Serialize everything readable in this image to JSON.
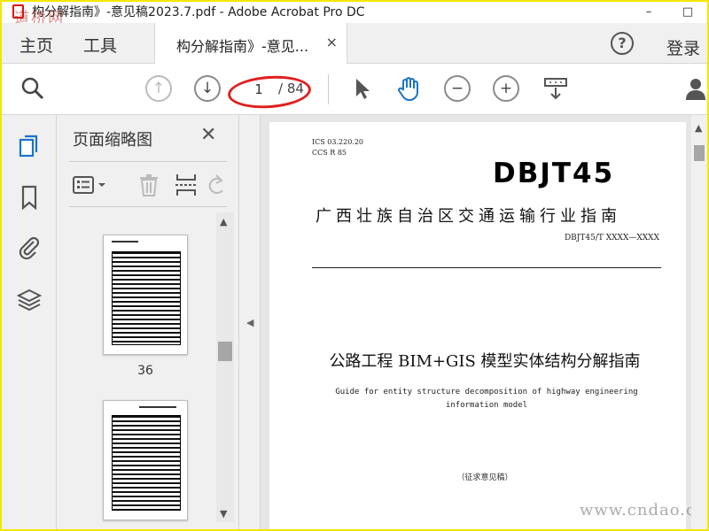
{
  "window": {
    "title": "构分解指南》-意见稿2023.7.pdf - Adobe Acrobat Pro DC",
    "controls": [
      "–",
      "□"
    ]
  },
  "watermark_top": "道桥网",
  "watermark_bottom": "www.cndao.com",
  "menu": {
    "home": "主页",
    "tools": "工具",
    "login": "登录"
  },
  "tab": {
    "label": "构分解指南》-意见...",
    "close": "×"
  },
  "toolbar": {
    "current_page": "1",
    "total_pages": "/ 84",
    "icons": [
      "search-icon",
      "prev-page-icon",
      "next-page-icon",
      "select-cursor-icon",
      "hand-tool-icon",
      "zoom-out-icon",
      "zoom-in-icon",
      "page-display-icon",
      "share-user-icon"
    ]
  },
  "panel": {
    "title": "页面缩略图",
    "close": "✕",
    "thumbnails": [
      {
        "page_number": "36"
      }
    ]
  },
  "document": {
    "ics": "ICS  03.220.20",
    "ccs": "CCS  R 85",
    "code": "DBJT45",
    "region_title": "广西壮族自治区交通运输行业指南",
    "standard_number": "DBJT45/T XXXX—XXXX",
    "main_title": "公路工程 BIM+GIS 模型实体结构分解指南",
    "english_title_line1": "Guide for entity structure decomposition of highway engineering",
    "english_title_line2": "information model",
    "draft_note": "（征求意见稿）"
  },
  "colors": {
    "border_yellow": "#f5e600",
    "annotation_red": "#e0201f",
    "active_blue": "#1a73c9"
  }
}
